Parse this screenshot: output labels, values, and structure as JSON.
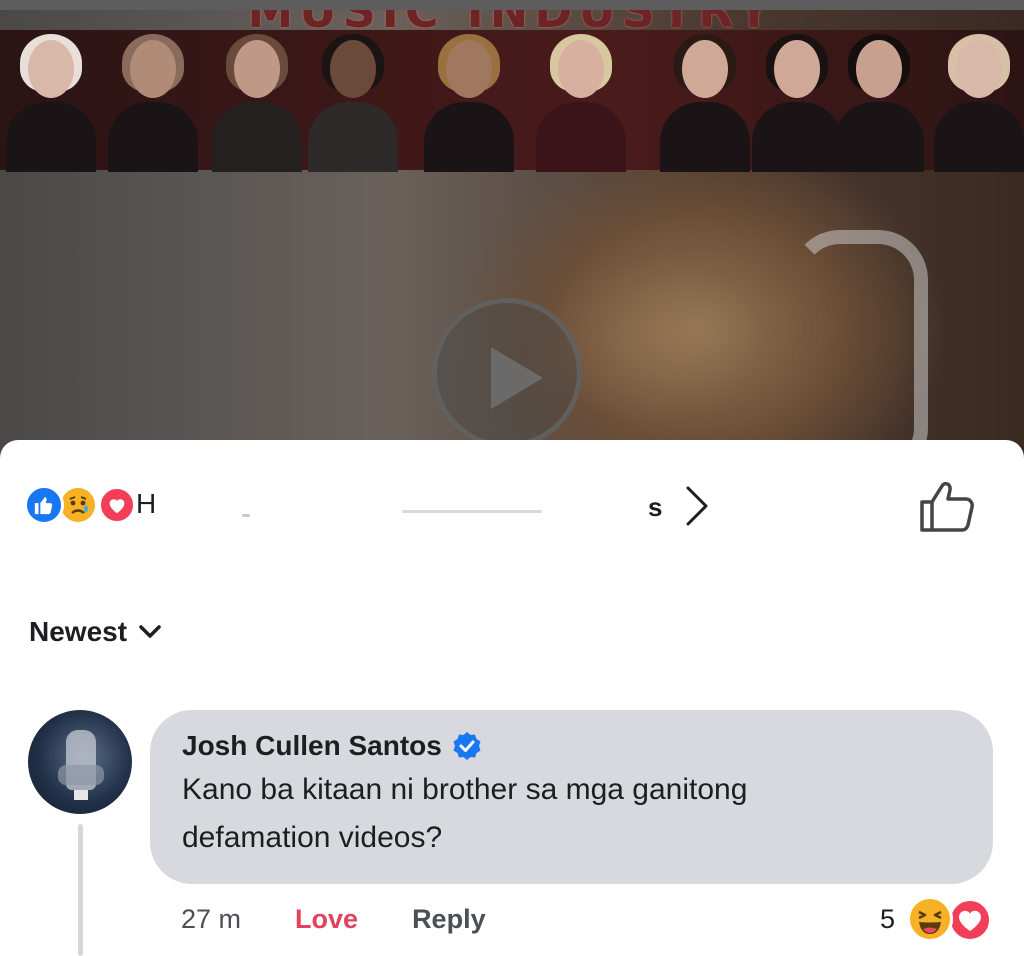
{
  "video": {
    "banner_title": "MUSIC INDUSTRY",
    "play_icon": "play-icon"
  },
  "post_reactions": {
    "icons": [
      "like-icon",
      "sad-icon",
      "love-icon"
    ],
    "name_start": "H",
    "name_end": "s",
    "chevron": "chevron-right-icon",
    "like_button_icon": "thumbs-up-icon"
  },
  "sort": {
    "label": "Newest",
    "icon": "chevron-down-icon"
  },
  "comment": {
    "author": "Josh Cullen Santos",
    "verified_icon": "verified-badge-icon",
    "text_line1": "Kano ba kitaan ni brother sa mga ganitong",
    "text_line2": "defamation videos?",
    "time": "27 m",
    "love_label": "Love",
    "reply_label": "Reply",
    "reaction_count": "5",
    "reaction_icons": [
      "haha-icon",
      "love-icon"
    ]
  },
  "colors": {
    "facebook_blue": "#1877f2",
    "love_red": "#f33e58",
    "haha_yellow": "#f7b125",
    "bubble_gray": "#d8d9de",
    "love_action": "#e2425c"
  }
}
